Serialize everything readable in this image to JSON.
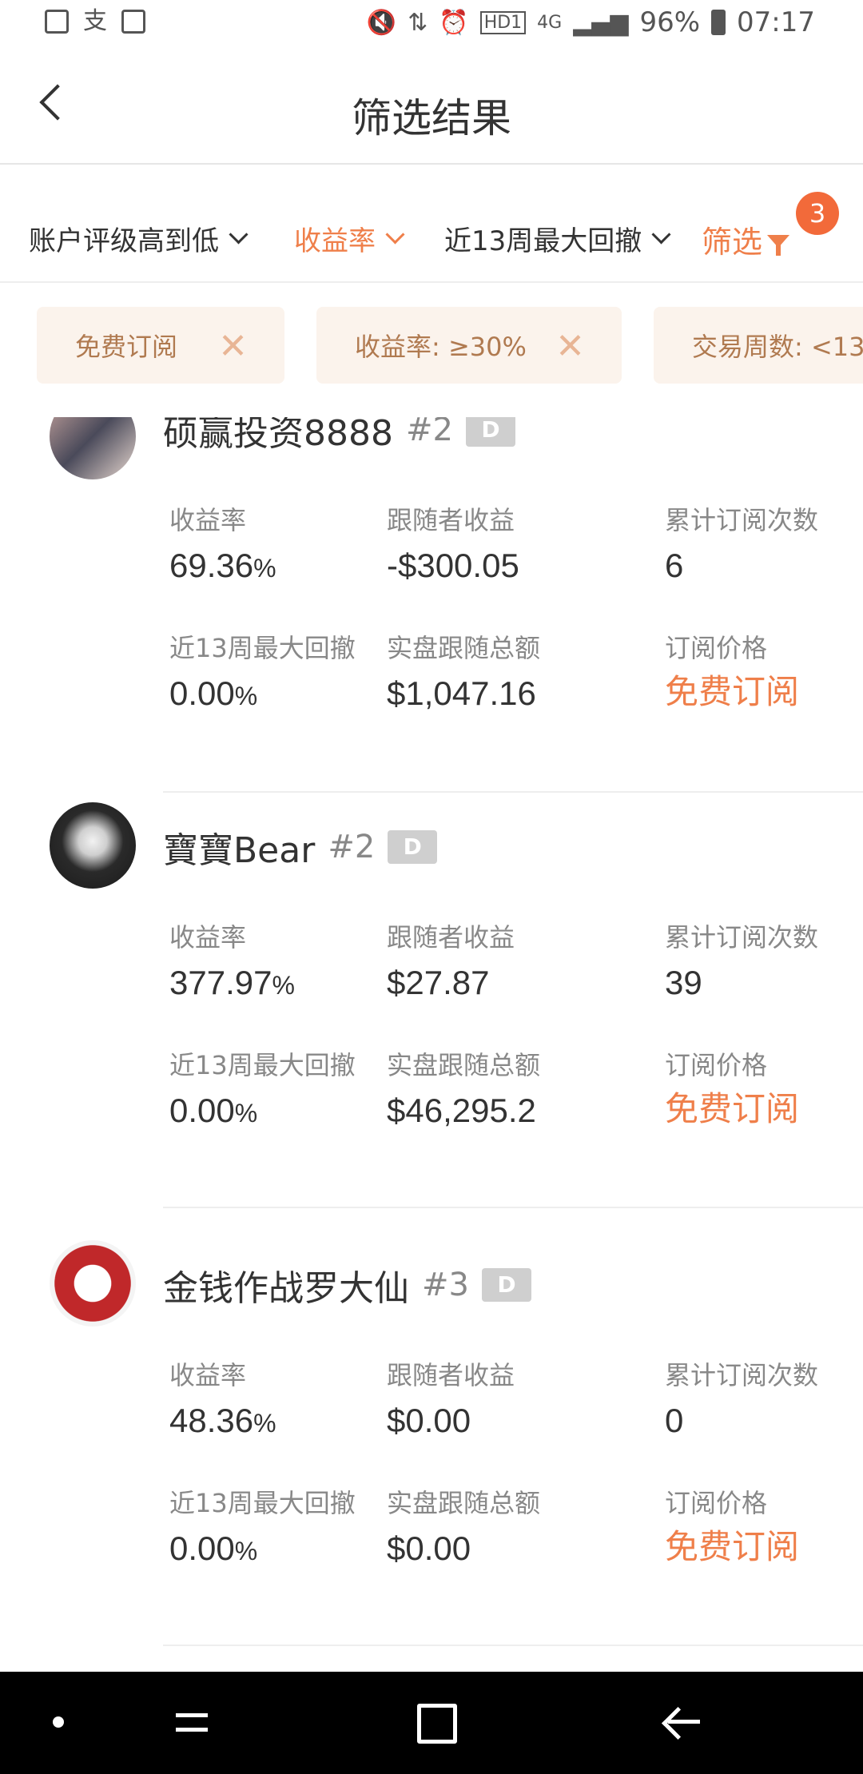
{
  "status": {
    "battery": "96%",
    "time": "07:17",
    "network": "4G",
    "hd": "HD1"
  },
  "header": {
    "title": "筛选结果"
  },
  "sort": {
    "rating": "账户评级高到低",
    "yield": "收益率",
    "drawdown": "近13周最大回撤",
    "filter": "筛选",
    "filter_count": "3"
  },
  "chips": [
    {
      "label": "免费订阅"
    },
    {
      "label": "收益率: ≥30%"
    },
    {
      "label": "交易周数: <13"
    }
  ],
  "labels": {
    "yield": "收益率",
    "follower_profit": "跟随者收益",
    "subs": "累计订阅次数",
    "drawdown": "近13周最大回撤",
    "total": "实盘跟随总额",
    "price": "订阅价格"
  },
  "units": {
    "percent": "%"
  },
  "tag": "D",
  "cards": [
    {
      "name": "硕赢投资8888",
      "rank": "#2",
      "yield": "69.36",
      "follower_profit": "-$300.05",
      "subs": "6",
      "drawdown": "0.00",
      "total": "$1,047.16",
      "price": "免费订阅"
    },
    {
      "name": "寶寶Bear",
      "rank": "#2",
      "yield": "377.97",
      "follower_profit": "$27.87",
      "subs": "39",
      "drawdown": "0.00",
      "total": "$46,295.2",
      "price": "免费订阅"
    },
    {
      "name": "金钱作战罗大仙",
      "rank": "#3",
      "yield": "48.36",
      "follower_profit": "$0.00",
      "subs": "0",
      "drawdown": "0.00",
      "total": "$0.00",
      "price": "免费订阅"
    }
  ],
  "colors": {
    "accent": "#ef7f4a",
    "badge": "#f26a3a",
    "chip_bg": "#fbf3ec"
  }
}
